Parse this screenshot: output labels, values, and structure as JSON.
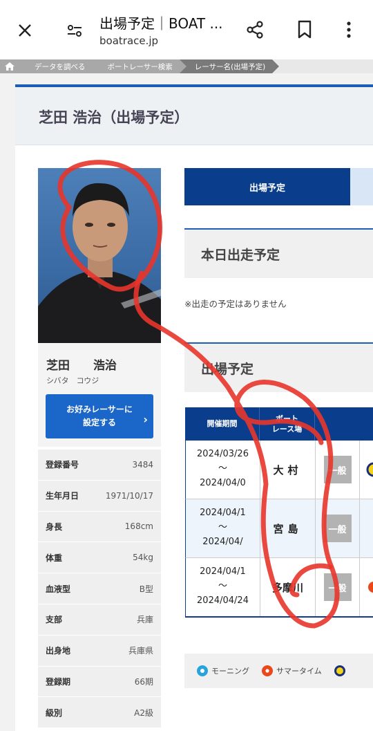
{
  "browser": {
    "title": "出場予定｜BOAT ...",
    "url": "boatrace.jp"
  },
  "breadcrumbs": [
    "データを調べる",
    "ボートレーサー検索",
    "レーサー名(出場予定)"
  ],
  "page_title": "芝田 浩治（出場予定）",
  "profile": {
    "name": "芝田　　浩治",
    "kana": "シバタ　コウジ",
    "fav_button": "お好みレーサーに\n設定する",
    "info": [
      {
        "label": "登録番号",
        "value": "3484"
      },
      {
        "label": "生年月日",
        "value": "1971/10/17"
      },
      {
        "label": "身長",
        "value": "168cm"
      },
      {
        "label": "体重",
        "value": "54kg"
      },
      {
        "label": "血液型",
        "value": "B型"
      },
      {
        "label": "支部",
        "value": "兵庫"
      },
      {
        "label": "出身地",
        "value": "兵庫県"
      },
      {
        "label": "登録期",
        "value": "66期"
      },
      {
        "label": "級別",
        "value": "A2級"
      }
    ]
  },
  "tabs": {
    "active": "出場予定"
  },
  "today": {
    "heading": "本日出走予定",
    "note": "※出走の予定はありません"
  },
  "schedule": {
    "heading": "出場予定",
    "headers": {
      "period": "開催期間",
      "venue": "ボート\nレース場"
    },
    "rows": [
      {
        "start": "2024/03/26",
        "tilde": "〜",
        "end": "2024/04/0",
        "venue": "大村",
        "grade": "一般"
      },
      {
        "start": "2024/04/1",
        "tilde": "〜",
        "end": "2024/04/",
        "venue": "宮島",
        "grade": "一般"
      },
      {
        "start": "2024/04/1",
        "tilde": "〜",
        "end": "2024/04/24",
        "venue": "多摩川",
        "grade": "一般"
      }
    ]
  },
  "legend": [
    {
      "label": "モーニング",
      "color": "#29a3dd"
    },
    {
      "label": "サマータイム",
      "color": "#e8481a"
    }
  ],
  "colors": {
    "accent": "#0a3d8c",
    "button": "#1b66c9",
    "annotation": "#e8352b"
  }
}
